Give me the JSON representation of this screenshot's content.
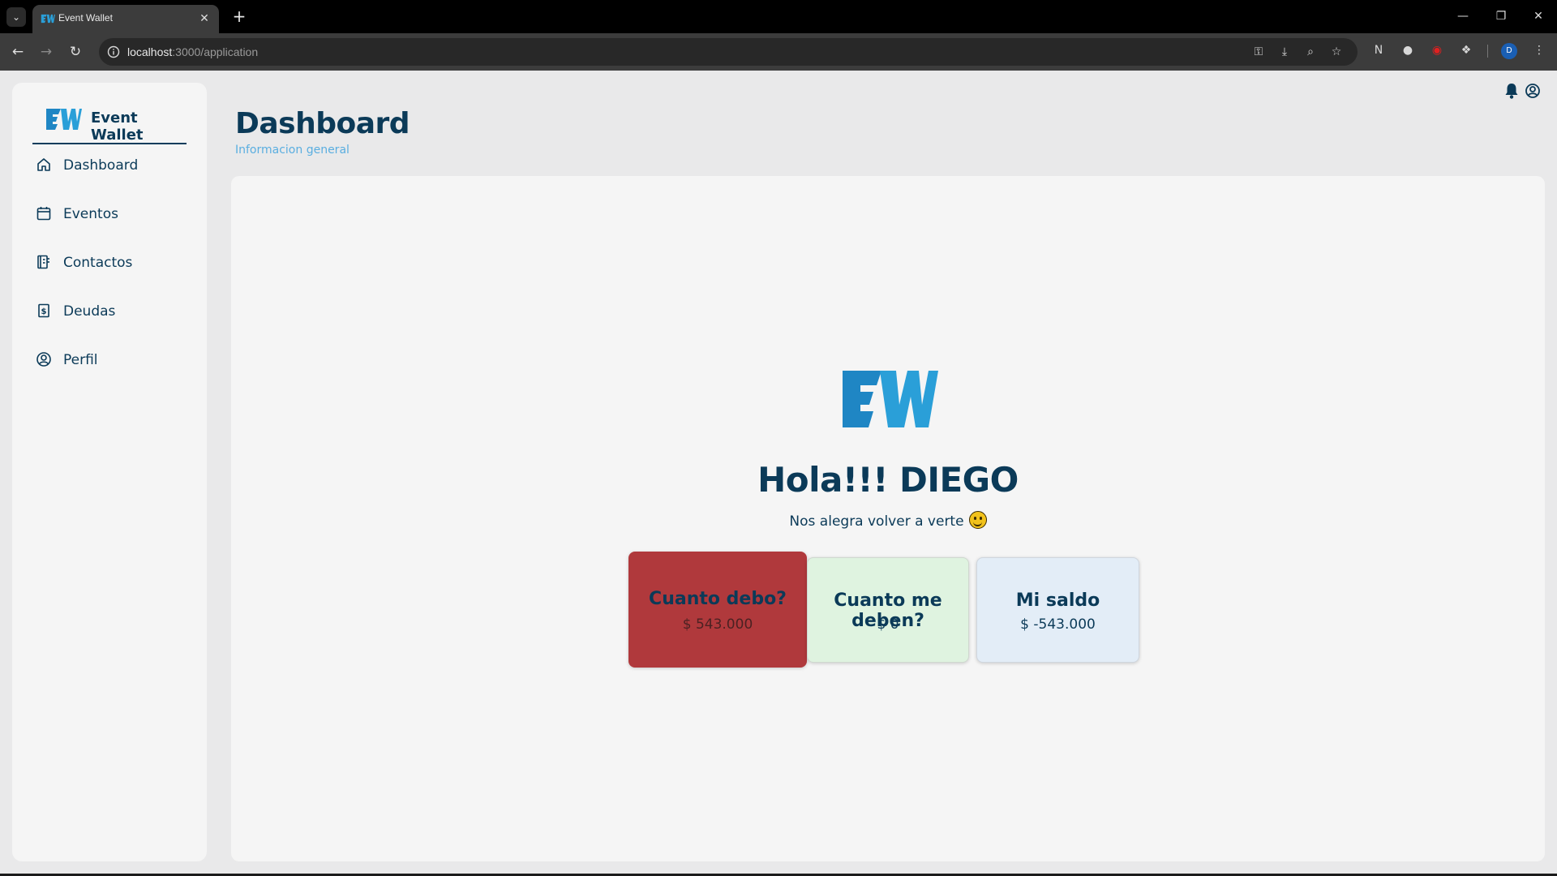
{
  "browser": {
    "tab_title": "Event Wallet",
    "url_host": "localhost",
    "url_rest": ":3000/application",
    "profile_initial": "D"
  },
  "sidebar": {
    "brand_name": "Event Wallet",
    "items": [
      {
        "label": "Dashboard",
        "icon": "home-icon"
      },
      {
        "label": "Eventos",
        "icon": "calendar-icon"
      },
      {
        "label": "Contactos",
        "icon": "contacts-book-icon"
      },
      {
        "label": "Deudas",
        "icon": "receipt-dollar-icon"
      },
      {
        "label": "Perfil",
        "icon": "user-circle-icon"
      }
    ]
  },
  "header": {
    "title": "Dashboard",
    "subtitle": "Informacion general"
  },
  "main": {
    "greeting": "Hola!!! DIEGO",
    "greeting_sub": "Nos alegra volver a verte",
    "cards": {
      "debo": {
        "title": "Cuanto debo?",
        "value": "$ 543.000"
      },
      "deben": {
        "title": "Cuanto me deben?",
        "value": "$ 0"
      },
      "saldo": {
        "title": "Mi saldo",
        "value": "$ -543.000"
      }
    }
  },
  "colors": {
    "brand_dark": "#0b3a58",
    "brand_light": "#2a9fd8",
    "accent_subtitle": "#5aaee0",
    "debt_card": "#b0393c",
    "owed_card": "#dff3e0",
    "balance_card": "#e3edf7"
  }
}
